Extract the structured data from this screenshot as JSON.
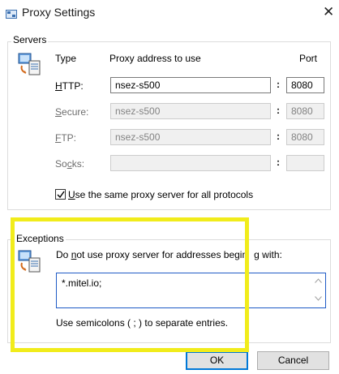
{
  "window": {
    "title": "Proxy Settings",
    "close_glyph": "✕"
  },
  "servers": {
    "legend": "Servers",
    "headers": {
      "type": "Type",
      "address": "Proxy address to use",
      "port": "Port"
    },
    "rows": [
      {
        "key": "H",
        "rest": "TTP:",
        "address": "nsez-s500",
        "port": "8080",
        "enabled": true
      },
      {
        "key": "S",
        "rest": "ecure:",
        "address": "nsez-s500",
        "port": "8080",
        "enabled": false
      },
      {
        "key": "F",
        "rest": "TP:",
        "address": "nsez-s500",
        "port": "8080",
        "enabled": false
      },
      {
        "pre": "So",
        "key": "c",
        "rest": "ks:",
        "address": "",
        "port": "",
        "enabled": false
      }
    ],
    "colon": ":",
    "same_proxy": {
      "key": "U",
      "rest": "se the same proxy server for all protocols",
      "checked": true
    }
  },
  "exceptions": {
    "legend": "Exceptions",
    "instruction_pre": "Do ",
    "instruction_key": "n",
    "instruction_rest": "ot use proxy server for addresses begin",
    "instruction_tail": "g with:",
    "value": "*.mitel.io;",
    "hint": "Use semicolons ( ; ) to separate entries."
  },
  "buttons": {
    "ok": "OK",
    "cancel": "Cancel"
  },
  "colors": {
    "highlight": "#f1ec1b",
    "focus": "#0078d7"
  }
}
